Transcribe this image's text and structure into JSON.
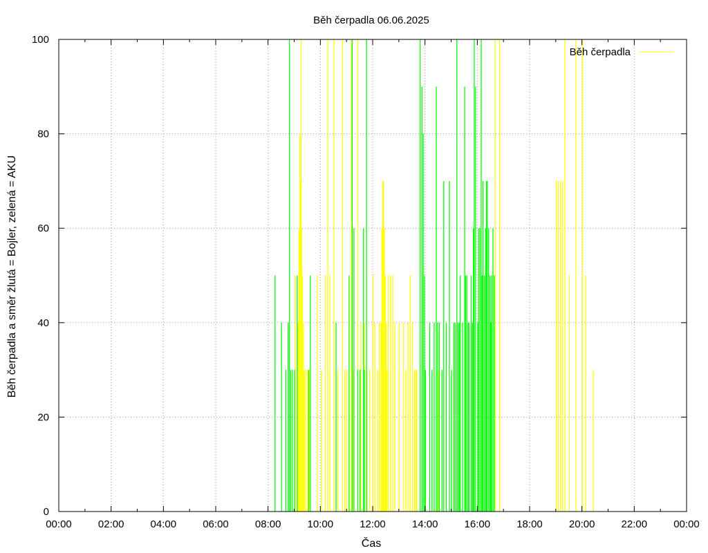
{
  "chart_data": {
    "type": "bar",
    "title": "Běh čerpadla 06.06.2025",
    "xlabel": "Čas",
    "ylabel": "Běh čerpadla a směr žlutá = Bojler, zelená = AKU",
    "xlim": [
      "00:00",
      "24:00"
    ],
    "ylim": [
      0,
      100
    ],
    "x_ticks": [
      "00:00",
      "02:00",
      "04:00",
      "06:00",
      "08:00",
      "10:00",
      "12:00",
      "14:00",
      "16:00",
      "18:00",
      "20:00",
      "22:00",
      "00:00"
    ],
    "y_ticks": [
      "0",
      "20",
      "40",
      "60",
      "80",
      "100"
    ],
    "grid": true,
    "legend": {
      "position": "top-right",
      "entries": [
        {
          "label": "Běh čerpadla",
          "color": "#ffff00"
        }
      ]
    },
    "series": [
      {
        "name": "Bojler",
        "color": "#ffff00",
        "points": [
          [
            "09:01",
            50
          ],
          [
            "09:06",
            30
          ],
          [
            "09:08",
            40
          ],
          [
            "09:10",
            60
          ],
          [
            "09:12",
            80
          ],
          [
            "09:14",
            70
          ],
          [
            "09:15",
            100
          ],
          [
            "09:16",
            60
          ],
          [
            "09:18",
            50
          ],
          [
            "09:20",
            40
          ],
          [
            "09:22",
            30
          ],
          [
            "09:25",
            30
          ],
          [
            "09:30",
            30
          ],
          [
            "09:34",
            30
          ],
          [
            "09:52",
            50
          ],
          [
            "10:02",
            30
          ],
          [
            "10:10",
            50
          ],
          [
            "10:16",
            100
          ],
          [
            "10:21",
            50
          ],
          [
            "10:30",
            100
          ],
          [
            "10:39",
            30
          ],
          [
            "10:50",
            100
          ],
          [
            "10:55",
            30
          ],
          [
            "11:00",
            30
          ],
          [
            "11:05",
            50
          ],
          [
            "11:10",
            100
          ],
          [
            "11:15",
            30
          ],
          [
            "11:25",
            100
          ],
          [
            "11:32",
            40
          ],
          [
            "11:40",
            40
          ],
          [
            "11:46",
            30
          ],
          [
            "11:52",
            30
          ],
          [
            "12:00",
            50
          ],
          [
            "12:04",
            40
          ],
          [
            "12:10",
            30
          ],
          [
            "12:14",
            40
          ],
          [
            "12:18",
            40
          ],
          [
            "12:20",
            60
          ],
          [
            "12:22",
            70
          ],
          [
            "12:24",
            70
          ],
          [
            "12:26",
            60
          ],
          [
            "12:28",
            50
          ],
          [
            "12:30",
            40
          ],
          [
            "12:32",
            30
          ],
          [
            "12:35",
            50
          ],
          [
            "12:40",
            50
          ],
          [
            "12:45",
            50
          ],
          [
            "12:50",
            40
          ],
          [
            "13:00",
            40
          ],
          [
            "13:10",
            40
          ],
          [
            "13:15",
            30
          ],
          [
            "13:20",
            40
          ],
          [
            "13:25",
            50
          ],
          [
            "13:30",
            40
          ],
          [
            "13:35",
            30
          ],
          [
            "13:38",
            30
          ],
          [
            "13:40",
            30
          ],
          [
            "14:30",
            30
          ],
          [
            "16:40",
            100
          ],
          [
            "16:50",
            100
          ],
          [
            "19:00",
            70
          ],
          [
            "19:05",
            70
          ],
          [
            "19:10",
            70
          ],
          [
            "19:15",
            70
          ],
          [
            "19:20",
            100
          ],
          [
            "19:30",
            50
          ],
          [
            "19:45",
            100
          ],
          [
            "20:00",
            100
          ],
          [
            "20:08",
            50
          ],
          [
            "20:25",
            30
          ]
        ]
      },
      {
        "name": "AKU",
        "color": "#00ff00",
        "points": [
          [
            "08:15",
            50
          ],
          [
            "08:30",
            40
          ],
          [
            "08:40",
            30
          ],
          [
            "08:45",
            40
          ],
          [
            "08:48",
            100
          ],
          [
            "08:51",
            30
          ],
          [
            "08:55",
            30
          ],
          [
            "09:00",
            30
          ],
          [
            "09:06",
            50
          ],
          [
            "09:32",
            30
          ],
          [
            "09:36",
            50
          ],
          [
            "10:35",
            40
          ],
          [
            "11:05",
            50
          ],
          [
            "11:12",
            100
          ],
          [
            "11:16",
            60
          ],
          [
            "11:25",
            30
          ],
          [
            "11:30",
            30
          ],
          [
            "11:38",
            60
          ],
          [
            "11:40",
            30
          ],
          [
            "11:45",
            100
          ],
          [
            "13:48",
            100
          ],
          [
            "13:52",
            90
          ],
          [
            "13:55",
            80
          ],
          [
            "13:58",
            50
          ],
          [
            "14:00",
            30
          ],
          [
            "14:10",
            40
          ],
          [
            "14:15",
            30
          ],
          [
            "14:20",
            40
          ],
          [
            "14:25",
            90
          ],
          [
            "14:28",
            40
          ],
          [
            "14:32",
            40
          ],
          [
            "14:38",
            30
          ],
          [
            "14:42",
            70
          ],
          [
            "14:48",
            40
          ],
          [
            "14:55",
            70
          ],
          [
            "15:00",
            30
          ],
          [
            "15:05",
            40
          ],
          [
            "15:08",
            40
          ],
          [
            "15:12",
            100
          ],
          [
            "15:15",
            40
          ],
          [
            "15:18",
            40
          ],
          [
            "15:20",
            50
          ],
          [
            "15:25",
            40
          ],
          [
            "15:30",
            90
          ],
          [
            "15:32",
            50
          ],
          [
            "15:35",
            50
          ],
          [
            "15:38",
            40
          ],
          [
            "15:40",
            40
          ],
          [
            "15:45",
            50
          ],
          [
            "15:48",
            40
          ],
          [
            "15:50",
            60
          ],
          [
            "15:52",
            100
          ],
          [
            "15:55",
            90
          ],
          [
            "16:00",
            40
          ],
          [
            "16:02",
            60
          ],
          [
            "16:05",
            60
          ],
          [
            "16:08",
            100
          ],
          [
            "16:10",
            50
          ],
          [
            "16:12",
            70
          ],
          [
            "16:15",
            50
          ],
          [
            "16:18",
            60
          ],
          [
            "16:20",
            70
          ],
          [
            "16:22",
            70
          ],
          [
            "16:25",
            60
          ],
          [
            "16:28",
            50
          ],
          [
            "16:30",
            40
          ],
          [
            "16:32",
            50
          ],
          [
            "16:35",
            60
          ],
          [
            "16:38",
            50
          ]
        ]
      }
    ]
  }
}
